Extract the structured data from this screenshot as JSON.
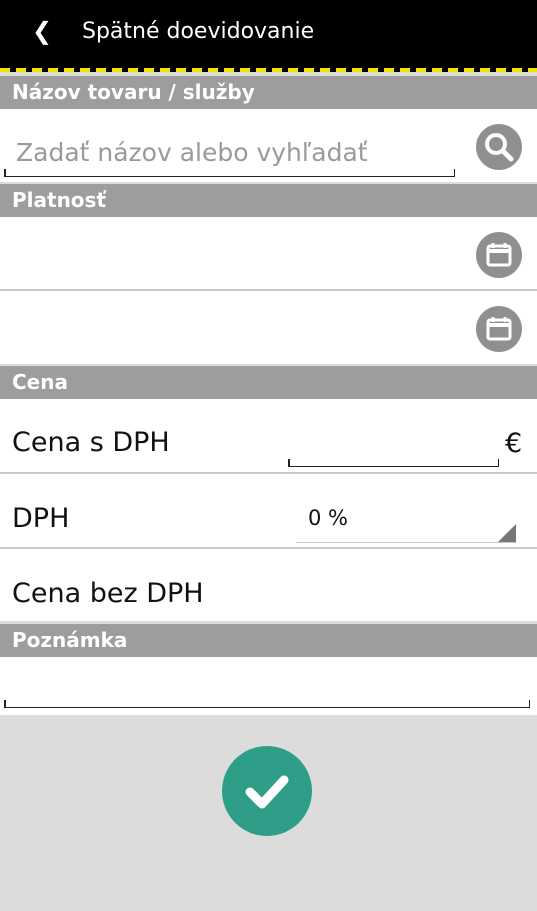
{
  "header": {
    "back_glyph": "❮",
    "title": "Spätné doevidovanie"
  },
  "sections": {
    "product": "Názov tovaru / služby",
    "validity": "Platnosť",
    "price": "Cena",
    "note": "Poznámka"
  },
  "product": {
    "search_placeholder": "Zadať názov alebo vyhľadať",
    "search_icon": "search-icon"
  },
  "validity": {
    "from_value": "",
    "to_value": "",
    "calendar_icon": "calendar-icon"
  },
  "price": {
    "with_vat_label": "Cena s DPH",
    "with_vat_value": "",
    "currency": "€",
    "vat_label": "DPH",
    "vat_value": "0 %",
    "without_vat_label": "Cena bez DPH"
  },
  "note": {
    "value": ""
  },
  "colors": {
    "header_bg": "#000000",
    "accent_yellow": "#f2e600",
    "section_bg": "#9d9d9d",
    "icon_button_bg": "#8f8f8f",
    "confirm_button_bg": "#2e9e88",
    "footer_bg": "#dcdcdc"
  }
}
